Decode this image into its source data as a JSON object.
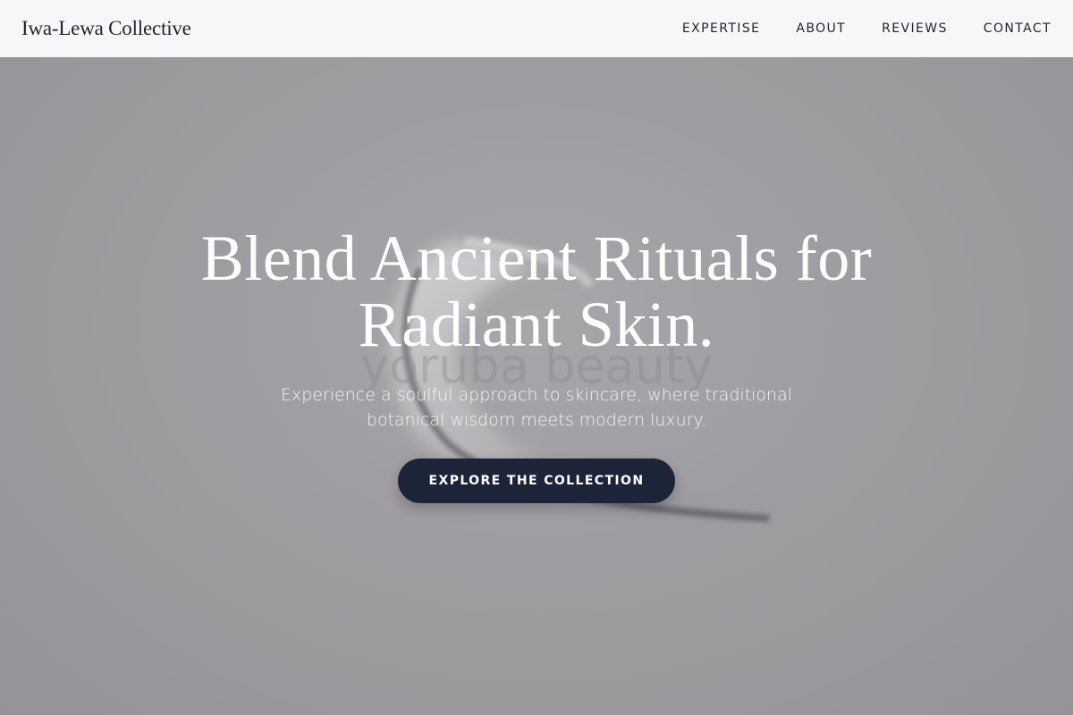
{
  "brand": {
    "name": "Iwa-Lewa Collective"
  },
  "nav": {
    "items": [
      {
        "label": "EXPERTISE"
      },
      {
        "label": "ABOUT"
      },
      {
        "label": "REVIEWS"
      },
      {
        "label": "CONTACT"
      }
    ]
  },
  "hero": {
    "headline": "Blend Ancient Rituals for Radiant Skin.",
    "subtext": "Experience a soulful approach to skincare, where traditional botanical wisdom meets modern luxury.",
    "cta_label": "EXPLORE THE COLLECTION",
    "background_watermark": "yoruba beauty"
  },
  "colors": {
    "navy": "#1c2538",
    "nav_bg": "#fafafa",
    "hero_bg": "#a8a6aa",
    "text_light": "#ffffff"
  }
}
